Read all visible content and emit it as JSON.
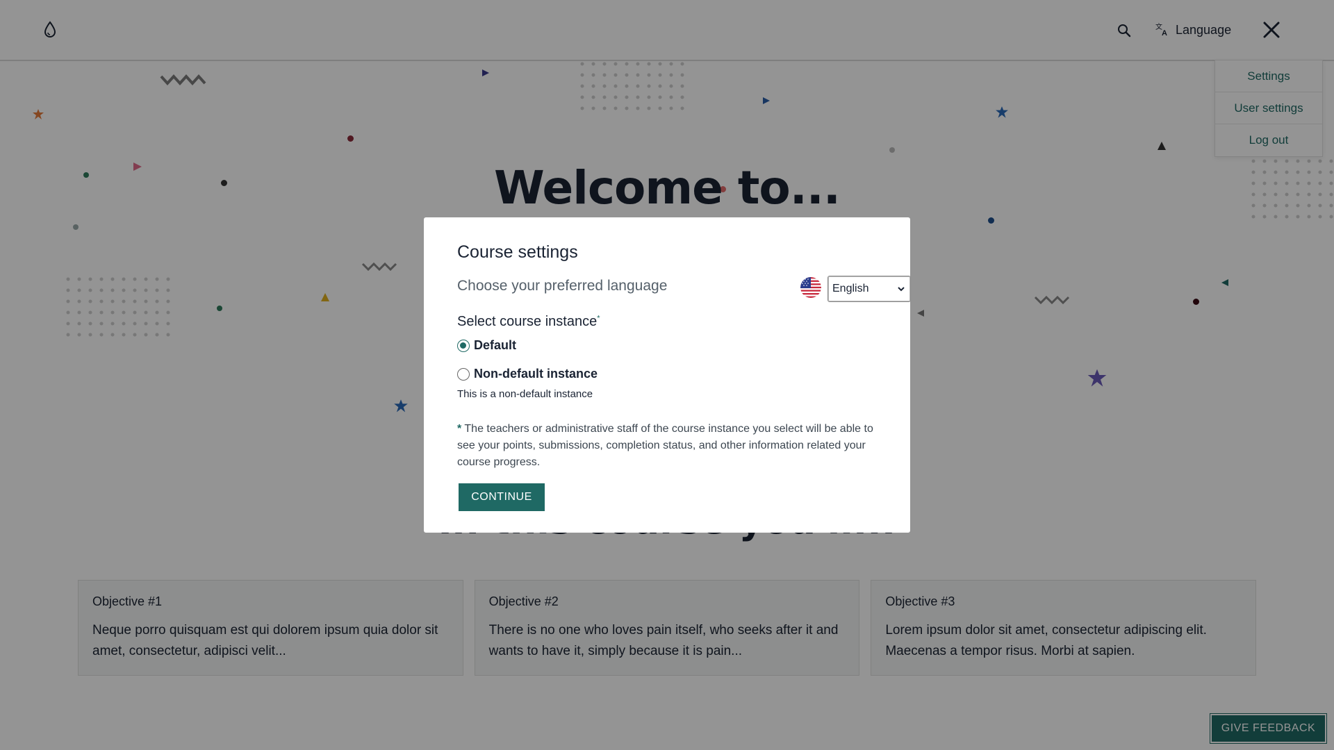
{
  "header": {
    "language_label": "Language"
  },
  "user_menu": {
    "items": [
      "Settings",
      "User settings",
      "Log out"
    ]
  },
  "hero": {
    "title": "Welcome to...",
    "section_title": "In this course you'll..."
  },
  "objectives": [
    {
      "title": "Objective #1",
      "text": "Neque porro quisquam est qui dolorem ipsum quia dolor sit amet, consectetur, adipisci velit..."
    },
    {
      "title": "Objective #2",
      "text": "There is no one who loves pain itself, who seeks after it and wants to have it, simply because it is pain..."
    },
    {
      "title": "Objective #3",
      "text": "Lorem ipsum dolor sit amet, consectetur adipiscing elit. Maecenas a tempor risus. Morbi at sapien."
    }
  ],
  "dialog": {
    "title": "Course settings",
    "language_prompt": "Choose your preferred language",
    "language_selected": "English",
    "instance_label": "Select course instance",
    "instance_required_mark": "*",
    "options": [
      {
        "label": "Default",
        "selected": true
      },
      {
        "label": "Non-default instance",
        "selected": false,
        "description": "This is a non-default instance"
      }
    ],
    "notice_star": "*",
    "notice": "The teachers or administrative staff of the course instance you select will be able to see your points, submissions, completion status, and other information related your course progress.",
    "continue_label": "CONTINUE"
  },
  "feedback_label": "GIVE FEEDBACK",
  "colors": {
    "accent": "#1f6964",
    "text": "#1a2333",
    "overlay": "rgba(0,0,0,0.42)"
  },
  "icons": {
    "logo": "drop-icon",
    "search": "search-icon",
    "language": "translate-icon",
    "close": "close-icon",
    "flag": "us-flag-icon"
  }
}
